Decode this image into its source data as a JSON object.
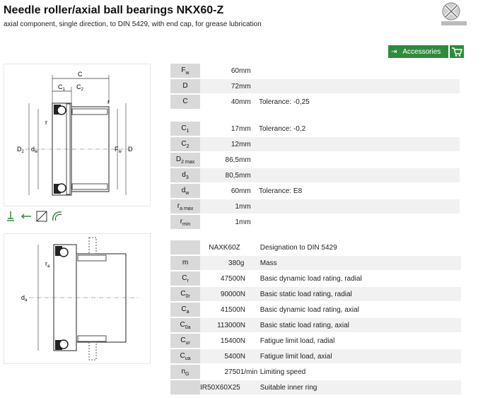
{
  "header": {
    "title": "Needle roller/axial ball bearings NKX60-Z",
    "subtitle": "axial component, single direction, to DIN 5429, with end cap, for grease lubrication",
    "accessories_label": "Accessories"
  },
  "drawing1": {
    "labels": {
      "C": "C",
      "C1": "C",
      "C2": "C",
      "r_top": "r",
      "r_left": "r",
      "D2": "D",
      "dw": "d",
      "Fw": "F",
      "D": "D"
    }
  },
  "drawing2": {
    "labels": {
      "ra": "r",
      "da": "d"
    }
  },
  "table1": [
    {
      "sym": "F",
      "sub": "w",
      "value": "60",
      "unit": "mm",
      "desc": ""
    },
    {
      "sym": "D",
      "sub": "",
      "value": "72",
      "unit": "mm",
      "desc": ""
    },
    {
      "sym": "C",
      "sub": "",
      "value": "40",
      "unit": "mm",
      "desc": "Tolerance: -0,25"
    }
  ],
  "table2": [
    {
      "sym": "C",
      "sub": "1",
      "value": "17",
      "unit": "mm",
      "desc": "Tolerance: -0,2"
    },
    {
      "sym": "C",
      "sub": "2",
      "value": "12",
      "unit": "mm",
      "desc": ""
    },
    {
      "sym": "D",
      "sub": "2 max",
      "value": "86,5",
      "unit": "mm",
      "desc": ""
    },
    {
      "sym": "d",
      "sub": "3",
      "value": "80,5",
      "unit": "mm",
      "desc": ""
    },
    {
      "sym": "d",
      "sub": "w",
      "value": "60",
      "unit": "mm",
      "desc": "Tolerance: E8"
    },
    {
      "sym": "r",
      "sub": "a max",
      "value": "1",
      "unit": "mm",
      "desc": ""
    },
    {
      "sym": "r",
      "sub": "min",
      "value": "1",
      "unit": "mm",
      "desc": ""
    }
  ],
  "table3": [
    {
      "sym": "",
      "sub": "",
      "value": "NAXK60Z",
      "unit": "",
      "desc": "Designation to DIN 5429"
    },
    {
      "sym": "m",
      "sub": "",
      "value": "380",
      "unit": "g",
      "desc": "Mass"
    },
    {
      "sym": "C",
      "sub": "r",
      "value": "47500",
      "unit": "N",
      "desc": "Basic dynamic load rating, radial"
    },
    {
      "sym": "C",
      "sub": "0r",
      "value": "90000",
      "unit": "N",
      "desc": "Basic static load rating, radial"
    },
    {
      "sym": "C",
      "sub": "a",
      "value": "41500",
      "unit": "N",
      "desc": "Basic dynamic load rating, axial"
    },
    {
      "sym": "C",
      "sub": "0a",
      "value": "113000",
      "unit": "N",
      "desc": "Basic static load rating, axial"
    },
    {
      "sym": "C",
      "sub": "ur",
      "value": "15400",
      "unit": "N",
      "desc": "Fatigue limit load, radial"
    },
    {
      "sym": "C",
      "sub": "ua",
      "value": "5400",
      "unit": "N",
      "desc": "Fatigue limit load, axial"
    },
    {
      "sym": "n",
      "sub": "G",
      "value": "2750",
      "unit": "1/min",
      "desc": "Limiting speed"
    },
    {
      "sym": "",
      "sub": "",
      "value": "IR50X60X25",
      "unit": "",
      "desc": "Suitable inner ring"
    }
  ]
}
